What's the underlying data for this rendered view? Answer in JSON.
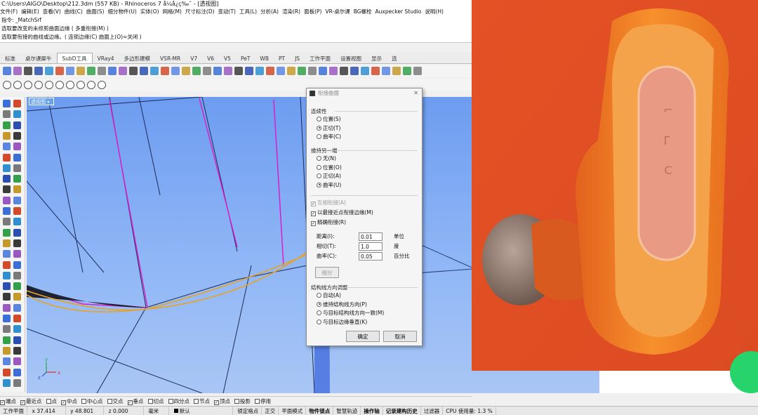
{
  "window": {
    "title": "C:\\Users\\AIGO\\Desktop\\212.3dm (557 KB) - Rhinoceros 7 å¼å¿ç‰ˆ - [透视图]"
  },
  "menu": [
    "文件(F)",
    "编辑(E)",
    "查看(V)",
    "曲线(C)",
    "曲面(S)",
    "细分物件(U)",
    "实体(O)",
    "网格(M)",
    "尺寸标注(D)",
    "变动(T)",
    "工具(L)",
    "分析(A)",
    "渲染(R)",
    "面板(P)",
    "VR-桌尔课",
    "BG螺栓",
    "Auxpecker Studio",
    "说明(H)"
  ],
  "command_history": [
    "指令: _MatchSrf",
    "选取要改变的未修剪曲面边缘 ( 多重衔接(M) )",
    "选取要衔接的曲线或边缘。( 连锁边缘(C)  曲面上(O)=关闭 )"
  ],
  "tabs": [
    "标准",
    "桌尔课犀牛",
    "SubD工具",
    "VRay4",
    "多边形建模",
    "VSR-MR",
    "V7",
    "V6",
    "V5",
    "PeT",
    "WB",
    "PT",
    "JS",
    "工作平面",
    "设置视图",
    "显示",
    "选"
  ],
  "active_tab": "SubD工具",
  "viewport": {
    "label": "透视图"
  },
  "axis": {
    "x": "x",
    "y": "y",
    "z": "z"
  },
  "dialog": {
    "title": "衔接曲面",
    "continuity": {
      "label": "连续性",
      "options": [
        "位置(S)",
        "正切(T)",
        "曲率(C)"
      ],
      "selected": 1
    },
    "preserve": {
      "label": "维持另一端",
      "options": [
        "无(N)",
        "位置(O)",
        "正切(A)",
        "曲率(U)"
      ],
      "selected": 3
    },
    "checks": [
      {
        "label": "互相衔接(A)",
        "checked": true,
        "disabled": true
      },
      {
        "label": "以最接近点衔接边缘(M)",
        "checked": true,
        "disabled": false
      },
      {
        "label": "精确衔接(R)",
        "checked": true,
        "disabled": false
      }
    ],
    "tolerances": [
      {
        "label": "距离(I):",
        "value": "0.01",
        "unit": "单位"
      },
      {
        "label": "相切(T):",
        "value": "1.0",
        "unit": "度"
      },
      {
        "label": "曲率(C):",
        "value": "0.05",
        "unit": "百分比"
      }
    ],
    "refine_button": "细分",
    "isocurve": {
      "label": "结构线方向调整",
      "options": [
        "自动(A)",
        "维持结构线方向(P)",
        "与目标结构线方向一致(M)",
        "与目标边缘垂直(K)"
      ],
      "selected": 1
    },
    "ok": "确定",
    "cancel": "取消"
  },
  "osnap": [
    {
      "label": "端点",
      "checked": true
    },
    {
      "label": "最近点",
      "checked": true
    },
    {
      "label": "点",
      "checked": false
    },
    {
      "label": "中点",
      "checked": true
    },
    {
      "label": "中心点",
      "checked": false
    },
    {
      "label": "交点",
      "checked": false
    },
    {
      "label": "垂点",
      "checked": true
    },
    {
      "label": "切点",
      "checked": false
    },
    {
      "label": "四分点",
      "checked": false
    },
    {
      "label": "节点",
      "checked": false
    },
    {
      "label": "顶点",
      "checked": true
    },
    {
      "label": "投影",
      "checked": false
    },
    {
      "label": "停用",
      "checked": false
    }
  ],
  "status": {
    "cplane": "工作平面",
    "x": "x 37.414",
    "y": "y 48.801",
    "z": "z 0.000",
    "unit": "毫米",
    "layer": "默认",
    "items": [
      "锁定格点",
      "正交",
      "平面模式",
      "物件锁点",
      "智慧轨迹",
      "操作轴",
      "记录建构历史",
      "过滤器",
      "CPU 使用量: 1.3 %"
    ],
    "bold_items": [
      "物件锁点",
      "操作轴",
      "记录建构历史"
    ]
  },
  "photo_marks": [
    "⌐",
    "ᒥ",
    "C"
  ]
}
